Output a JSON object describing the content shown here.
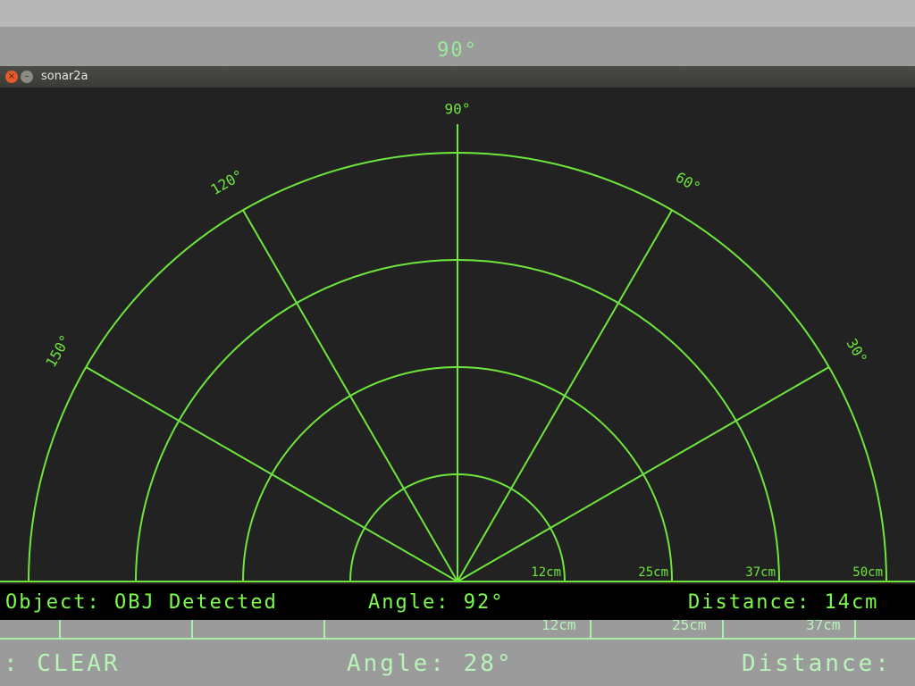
{
  "background_window": {
    "angle_label": "90°",
    "status": {
      "object": ": CLEAR",
      "angle": "Angle: 28°",
      "distance": "Distance:"
    },
    "grid_labels": [
      "12cm",
      "25cm",
      "37cm"
    ]
  },
  "window": {
    "title": "sonar2a",
    "close_glyph": "×",
    "minimize_glyph": "–"
  },
  "radar": {
    "angles": [
      {
        "deg": 150,
        "label": "150°"
      },
      {
        "deg": 120,
        "label": "120°"
      },
      {
        "deg": 90,
        "label": "90°"
      },
      {
        "deg": 60,
        "label": "60°"
      },
      {
        "deg": 30,
        "label": "30°"
      }
    ],
    "rings": [
      {
        "label": "12cm"
      },
      {
        "label": "25cm"
      },
      {
        "label": "37cm"
      },
      {
        "label": "50cm"
      }
    ],
    "color": "#6ee63c"
  },
  "status": {
    "object": "Object: OBJ Detected",
    "angle": "Angle: 92°",
    "distance": "Distance: 14cm"
  }
}
